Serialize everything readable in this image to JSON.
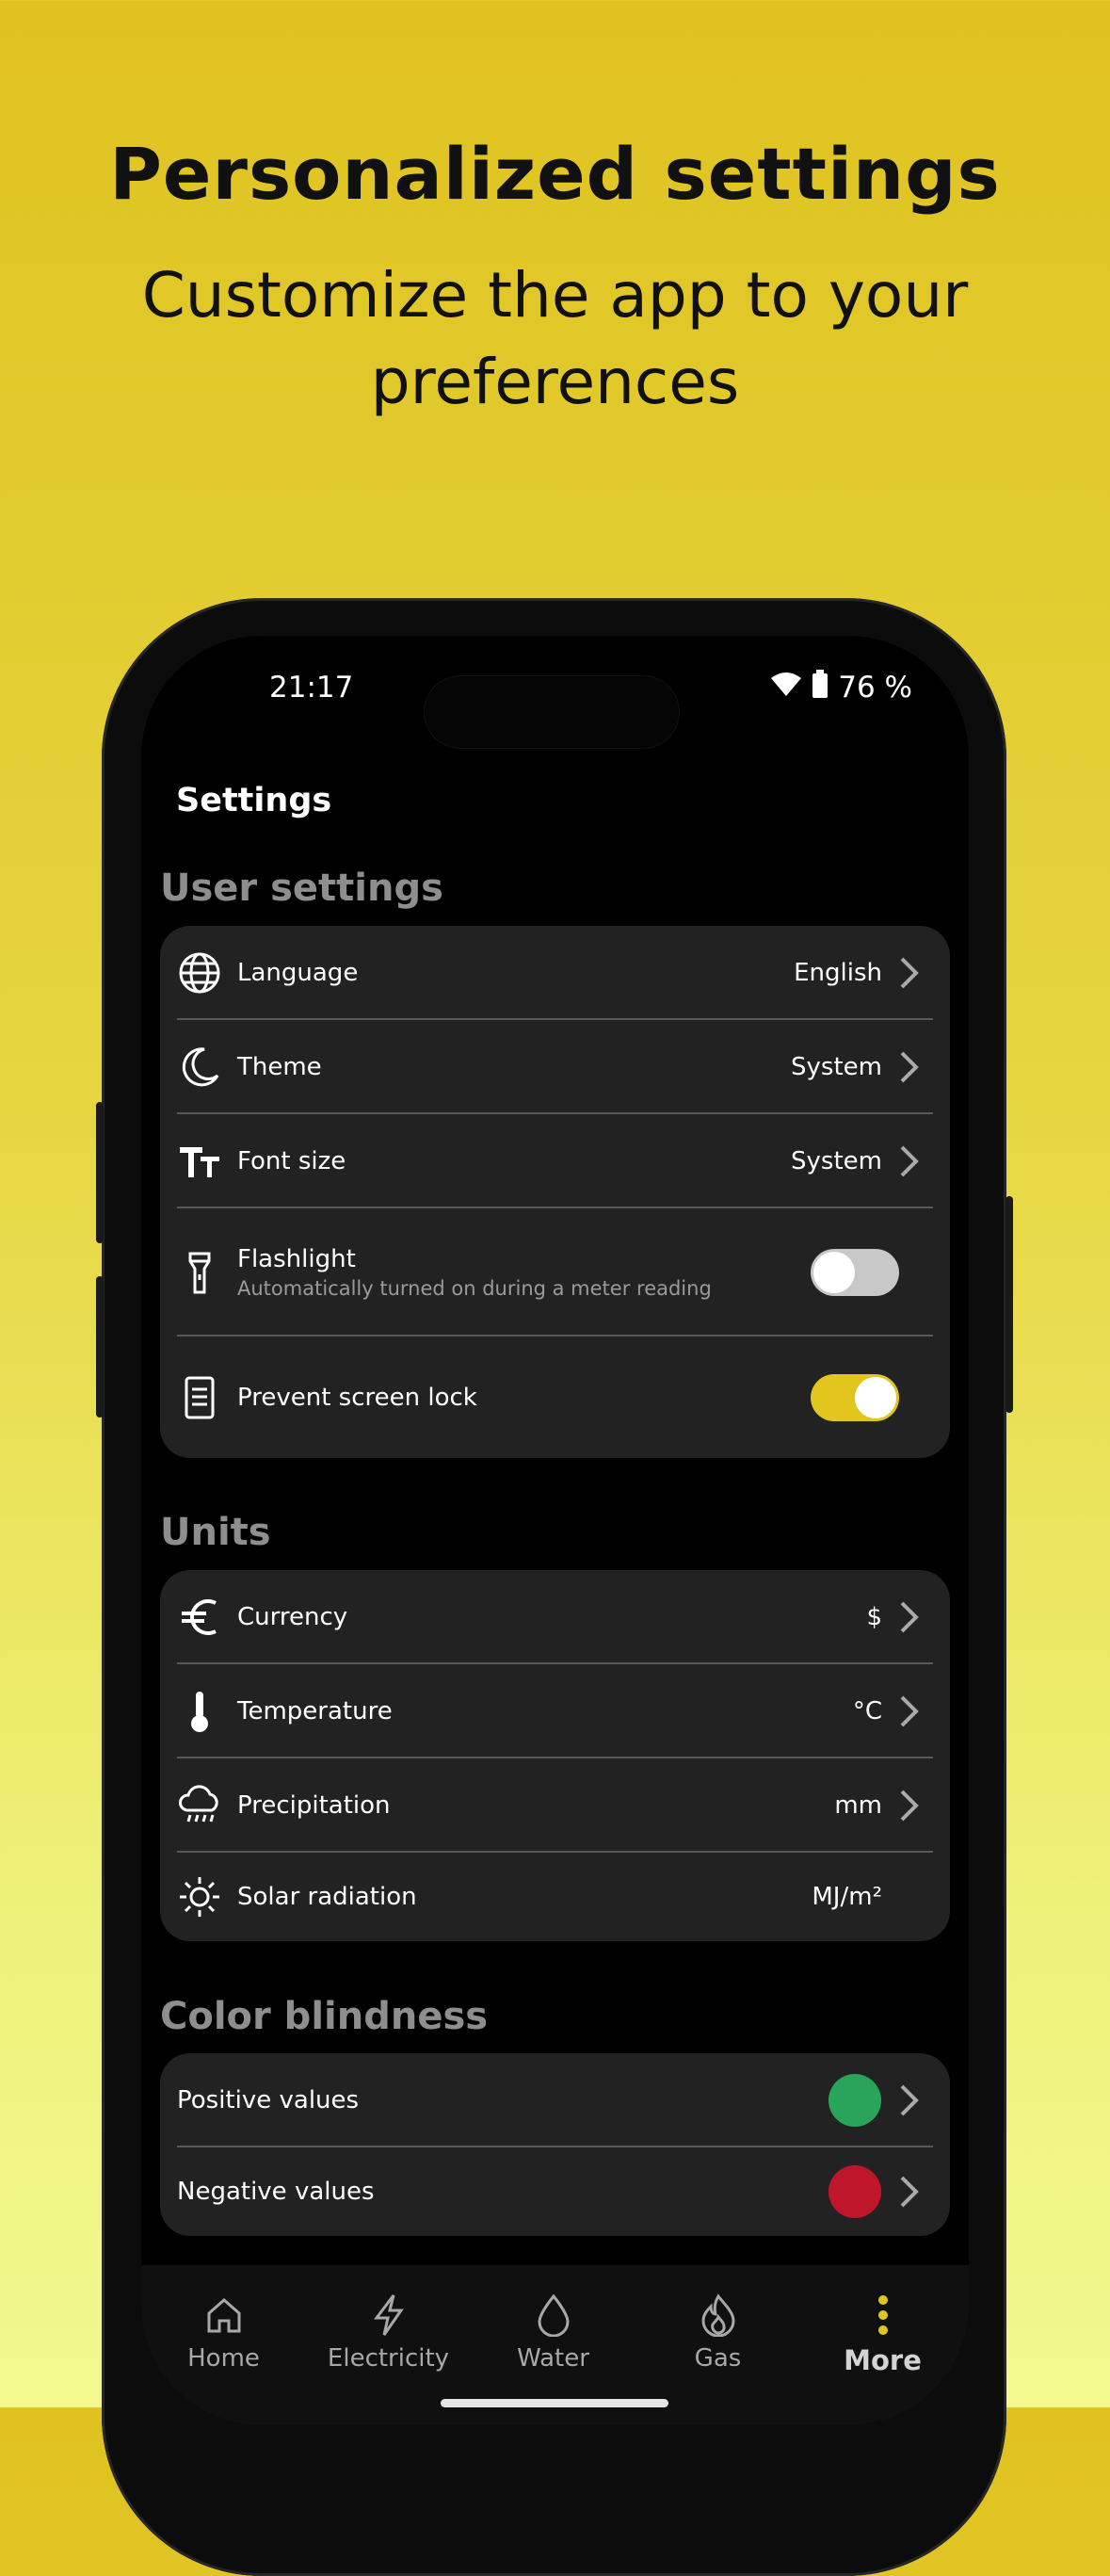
{
  "promo": {
    "headline": "Personalized settings",
    "subline": "Customize the app to your preferences"
  },
  "status_bar": {
    "time": "21:17",
    "battery": "76 %"
  },
  "app": {
    "title": "Settings"
  },
  "user_settings": {
    "title": "User settings",
    "language": {
      "label": "Language",
      "value": "English",
      "icon": "globe-icon"
    },
    "theme": {
      "label": "Theme",
      "value": "System",
      "icon": "moon-icon"
    },
    "font_size": {
      "label": "Font size",
      "value": "System",
      "icon": "text-size-icon"
    },
    "flashlight": {
      "label": "Flashlight",
      "sublabel": "Automatically turned on during a meter reading",
      "icon": "flashlight-icon",
      "enabled": false
    },
    "screen_lock": {
      "label": "Prevent screen lock",
      "icon": "phone-icon",
      "enabled": true
    }
  },
  "units": {
    "title": "Units",
    "currency": {
      "label": "Currency",
      "value": "$",
      "icon": "euro-icon"
    },
    "temperature": {
      "label": "Temperature",
      "value": "°C",
      "icon": "thermometer-icon"
    },
    "precipitation": {
      "label": "Precipitation",
      "value": "mm",
      "icon": "rain-cloud-icon"
    },
    "solar": {
      "label": "Solar radiation",
      "value": "MJ/m²",
      "icon": "sun-icon"
    }
  },
  "color_blindness": {
    "title": "Color blindness",
    "positive": {
      "label": "Positive values",
      "color": "#2aa45a"
    },
    "negative": {
      "label": "Negative values",
      "color": "#c0162c"
    }
  },
  "tabs": [
    {
      "label": "Home",
      "icon": "home-icon"
    },
    {
      "label": "Electricity",
      "icon": "lightning-icon"
    },
    {
      "label": "Water",
      "icon": "water-drop-icon"
    },
    {
      "label": "Gas",
      "icon": "flame-icon"
    },
    {
      "label": "More",
      "icon": "more-vertical-icon"
    }
  ],
  "colors": {
    "accent": "#e2c61e",
    "card": "#222222",
    "toggle_off": "#c8c8c8"
  }
}
